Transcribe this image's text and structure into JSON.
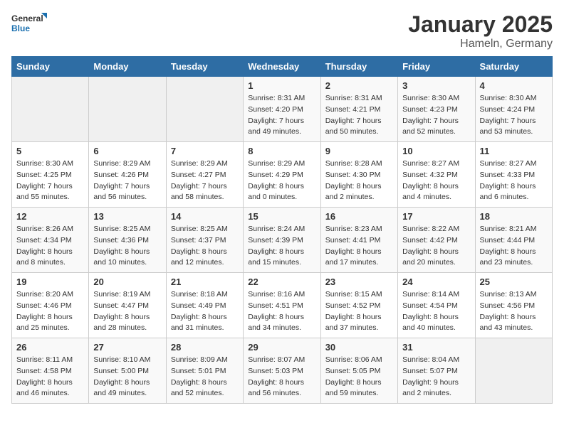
{
  "header": {
    "logo_general": "General",
    "logo_blue": "Blue",
    "title": "January 2025",
    "subtitle": "Hameln, Germany"
  },
  "days_of_week": [
    "Sunday",
    "Monday",
    "Tuesday",
    "Wednesday",
    "Thursday",
    "Friday",
    "Saturday"
  ],
  "weeks": [
    [
      {
        "day": "",
        "info": ""
      },
      {
        "day": "",
        "info": ""
      },
      {
        "day": "",
        "info": ""
      },
      {
        "day": "1",
        "info": "Sunrise: 8:31 AM\nSunset: 4:20 PM\nDaylight: 7 hours\nand 49 minutes."
      },
      {
        "day": "2",
        "info": "Sunrise: 8:31 AM\nSunset: 4:21 PM\nDaylight: 7 hours\nand 50 minutes."
      },
      {
        "day": "3",
        "info": "Sunrise: 8:30 AM\nSunset: 4:23 PM\nDaylight: 7 hours\nand 52 minutes."
      },
      {
        "day": "4",
        "info": "Sunrise: 8:30 AM\nSunset: 4:24 PM\nDaylight: 7 hours\nand 53 minutes."
      }
    ],
    [
      {
        "day": "5",
        "info": "Sunrise: 8:30 AM\nSunset: 4:25 PM\nDaylight: 7 hours\nand 55 minutes."
      },
      {
        "day": "6",
        "info": "Sunrise: 8:29 AM\nSunset: 4:26 PM\nDaylight: 7 hours\nand 56 minutes."
      },
      {
        "day": "7",
        "info": "Sunrise: 8:29 AM\nSunset: 4:27 PM\nDaylight: 7 hours\nand 58 minutes."
      },
      {
        "day": "8",
        "info": "Sunrise: 8:29 AM\nSunset: 4:29 PM\nDaylight: 8 hours\nand 0 minutes."
      },
      {
        "day": "9",
        "info": "Sunrise: 8:28 AM\nSunset: 4:30 PM\nDaylight: 8 hours\nand 2 minutes."
      },
      {
        "day": "10",
        "info": "Sunrise: 8:27 AM\nSunset: 4:32 PM\nDaylight: 8 hours\nand 4 minutes."
      },
      {
        "day": "11",
        "info": "Sunrise: 8:27 AM\nSunset: 4:33 PM\nDaylight: 8 hours\nand 6 minutes."
      }
    ],
    [
      {
        "day": "12",
        "info": "Sunrise: 8:26 AM\nSunset: 4:34 PM\nDaylight: 8 hours\nand 8 minutes."
      },
      {
        "day": "13",
        "info": "Sunrise: 8:25 AM\nSunset: 4:36 PM\nDaylight: 8 hours\nand 10 minutes."
      },
      {
        "day": "14",
        "info": "Sunrise: 8:25 AM\nSunset: 4:37 PM\nDaylight: 8 hours\nand 12 minutes."
      },
      {
        "day": "15",
        "info": "Sunrise: 8:24 AM\nSunset: 4:39 PM\nDaylight: 8 hours\nand 15 minutes."
      },
      {
        "day": "16",
        "info": "Sunrise: 8:23 AM\nSunset: 4:41 PM\nDaylight: 8 hours\nand 17 minutes."
      },
      {
        "day": "17",
        "info": "Sunrise: 8:22 AM\nSunset: 4:42 PM\nDaylight: 8 hours\nand 20 minutes."
      },
      {
        "day": "18",
        "info": "Sunrise: 8:21 AM\nSunset: 4:44 PM\nDaylight: 8 hours\nand 23 minutes."
      }
    ],
    [
      {
        "day": "19",
        "info": "Sunrise: 8:20 AM\nSunset: 4:46 PM\nDaylight: 8 hours\nand 25 minutes."
      },
      {
        "day": "20",
        "info": "Sunrise: 8:19 AM\nSunset: 4:47 PM\nDaylight: 8 hours\nand 28 minutes."
      },
      {
        "day": "21",
        "info": "Sunrise: 8:18 AM\nSunset: 4:49 PM\nDaylight: 8 hours\nand 31 minutes."
      },
      {
        "day": "22",
        "info": "Sunrise: 8:16 AM\nSunset: 4:51 PM\nDaylight: 8 hours\nand 34 minutes."
      },
      {
        "day": "23",
        "info": "Sunrise: 8:15 AM\nSunset: 4:52 PM\nDaylight: 8 hours\nand 37 minutes."
      },
      {
        "day": "24",
        "info": "Sunrise: 8:14 AM\nSunset: 4:54 PM\nDaylight: 8 hours\nand 40 minutes."
      },
      {
        "day": "25",
        "info": "Sunrise: 8:13 AM\nSunset: 4:56 PM\nDaylight: 8 hours\nand 43 minutes."
      }
    ],
    [
      {
        "day": "26",
        "info": "Sunrise: 8:11 AM\nSunset: 4:58 PM\nDaylight: 8 hours\nand 46 minutes."
      },
      {
        "day": "27",
        "info": "Sunrise: 8:10 AM\nSunset: 5:00 PM\nDaylight: 8 hours\nand 49 minutes."
      },
      {
        "day": "28",
        "info": "Sunrise: 8:09 AM\nSunset: 5:01 PM\nDaylight: 8 hours\nand 52 minutes."
      },
      {
        "day": "29",
        "info": "Sunrise: 8:07 AM\nSunset: 5:03 PM\nDaylight: 8 hours\nand 56 minutes."
      },
      {
        "day": "30",
        "info": "Sunrise: 8:06 AM\nSunset: 5:05 PM\nDaylight: 8 hours\nand 59 minutes."
      },
      {
        "day": "31",
        "info": "Sunrise: 8:04 AM\nSunset: 5:07 PM\nDaylight: 9 hours\nand 2 minutes."
      },
      {
        "day": "",
        "info": ""
      }
    ]
  ]
}
